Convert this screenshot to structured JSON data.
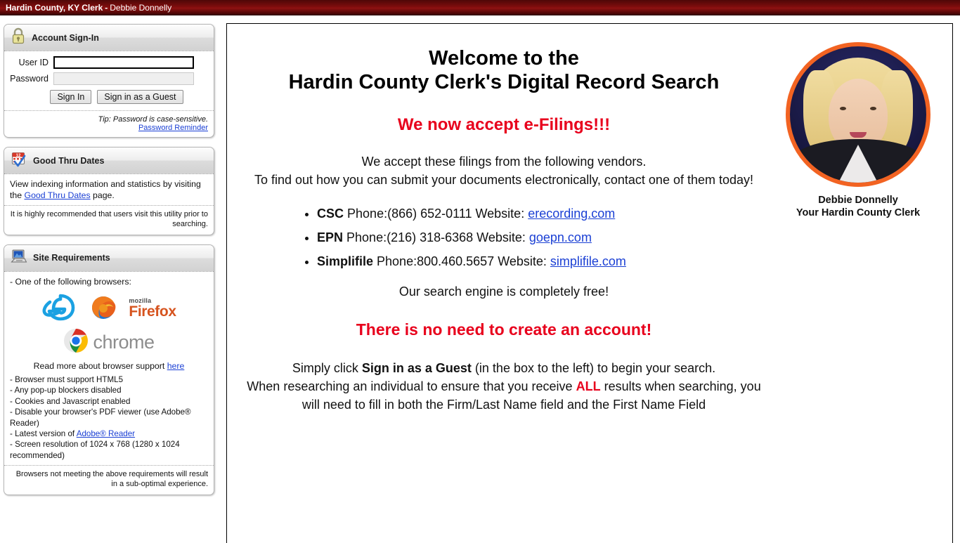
{
  "titlebar": {
    "county": "Hardin County, KY Clerk",
    "separator": "-",
    "clerk": "Debbie Donnelly"
  },
  "signin_panel": {
    "icon": "lock-icon",
    "title": "Account Sign-In",
    "userid_label": "User ID",
    "userid_value": "",
    "password_label": "Password",
    "password_value": "",
    "signin_button": "Sign In",
    "guest_button": "Sign in as a Guest",
    "tip": "Tip: Password is case-sensitive.",
    "password_reminder_link": "Password Reminder"
  },
  "good_thru_panel": {
    "icon": "calendar-icon",
    "icon_day": "12",
    "title": "Good Thru Dates",
    "text_before_link": "View indexing information and statistics by visiting the ",
    "link": "Good Thru Dates",
    "text_after_link": " page.",
    "note": "It is highly recommended that users visit this utility prior to searching."
  },
  "site_requirements_panel": {
    "icon": "computer-icon",
    "title": "Site Requirements",
    "lead": "- One of the following browsers:",
    "browsers": [
      {
        "name": "internet-explorer",
        "label": "e"
      },
      {
        "name": "firefox",
        "label_small": "mozilla",
        "label_big": "Firefox"
      },
      {
        "name": "chrome",
        "label": "chrome"
      }
    ],
    "readmore_text": "Read more about browser support ",
    "readmore_link": "here",
    "requirements": [
      "- Browser must support HTML5",
      "- Any pop-up blockers disabled",
      "- Cookies and Javascript enabled",
      "- Disable your browser's PDF viewer (use Adobe® Reader)"
    ],
    "adobe_req_before": "- Latest version of ",
    "adobe_req_link": "Adobe® Reader",
    "resolution_req": "- Screen resolution of 1024 x 768 (1280 x 1024 recommended)",
    "footer_note": "Browsers not meeting the above requirements will result in a sub-optimal experience."
  },
  "main": {
    "welcome_line1": "Welcome to the",
    "welcome_line2": "Hardin County Clerk's Digital Record Search",
    "efiling_heading": "We now accept e-Filings!!!",
    "vendor_intro_line1": "We accept these filings from the following vendors.",
    "vendor_intro_line2": "To find out how you can submit your documents electronically, contact one of them today!",
    "vendors": [
      {
        "name": "CSC",
        "phone": "Phone:(866) 652-0111 Website: ",
        "website": "erecording.com"
      },
      {
        "name": "EPN",
        "phone": "Phone:(216) 318-6368 Website: ",
        "website": "goepn.com"
      },
      {
        "name": "Simplifile",
        "phone": "Phone:800.460.5657 Website: ",
        "website": "simplifile.com"
      }
    ],
    "free_line": "Our search engine is completely free!",
    "no_account_heading": "There is no need to create an account!",
    "guest_before": "Simply click ",
    "guest_bold": "Sign in as a Guest",
    "guest_after": " (in the box to the left) to begin your search.",
    "research_before": "When researching an individual to ensure that you receive ",
    "research_all": "ALL",
    "research_after": " results when searching, you will need to fill in both the Firm/Last Name field and the First Name Field",
    "portrait": {
      "alt": "clerk-portrait",
      "name": "Debbie Donnelly",
      "role": "Your Hardin County Clerk"
    }
  },
  "colors": {
    "titlebar_red": "#8f1111",
    "alert_red": "#e8001c",
    "link_blue": "#1a3fd4",
    "portrait_ring_orange": "#f26322"
  }
}
